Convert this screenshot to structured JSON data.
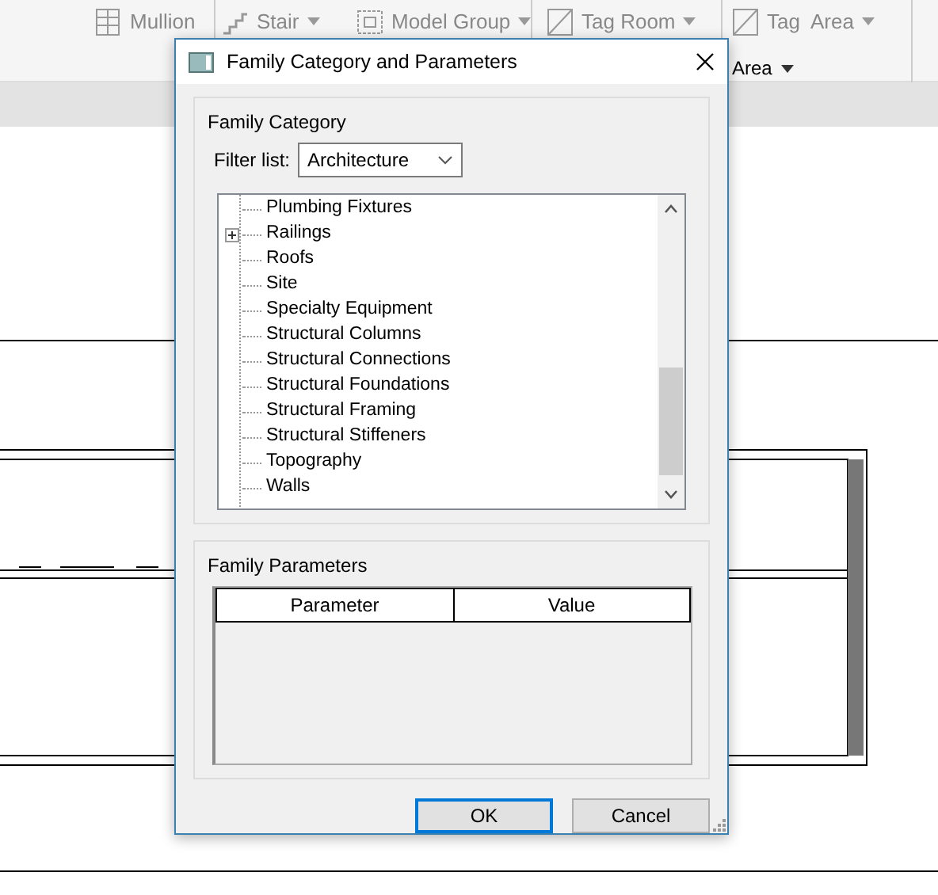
{
  "ribbon": {
    "tools": [
      {
        "label": "Mullion",
        "kind": "grid",
        "caret": false
      },
      {
        "label": "Stair",
        "kind": "stair",
        "caret": true
      },
      {
        "label": "Model Group",
        "kind": "group",
        "caret": true
      },
      {
        "label": "Tag Room",
        "kind": "tag",
        "caret": true
      },
      {
        "label": "Tag  Area",
        "kind": "tag",
        "caret": true
      }
    ],
    "panel_label": "Area"
  },
  "dialog": {
    "title": "Family Category and Parameters",
    "category_group": {
      "title": "Family Category",
      "filter_label": "Filter list:",
      "filter_value": "Architecture",
      "items": [
        {
          "label": "Plumbing Fixtures",
          "kind": "leaf"
        },
        {
          "label": "Railings",
          "kind": "node",
          "expanded": false
        },
        {
          "label": "Roofs",
          "kind": "leaf"
        },
        {
          "label": "Site",
          "kind": "leaf"
        },
        {
          "label": "Specialty Equipment",
          "kind": "leaf"
        },
        {
          "label": "Structural Columns",
          "kind": "leaf"
        },
        {
          "label": "Structural Connections",
          "kind": "leaf"
        },
        {
          "label": "Structural Foundations",
          "kind": "leaf"
        },
        {
          "label": "Structural Framing",
          "kind": "leaf"
        },
        {
          "label": "Structural Stiffeners",
          "kind": "leaf"
        },
        {
          "label": "Topography",
          "kind": "leaf"
        },
        {
          "label": "Walls",
          "kind": "leaf"
        }
      ]
    },
    "parameters_group": {
      "title": "Family Parameters",
      "columns": [
        "Parameter",
        "Value"
      ]
    },
    "buttons": [
      {
        "label": "OK",
        "default": true
      },
      {
        "label": "Cancel",
        "default": false
      }
    ]
  }
}
